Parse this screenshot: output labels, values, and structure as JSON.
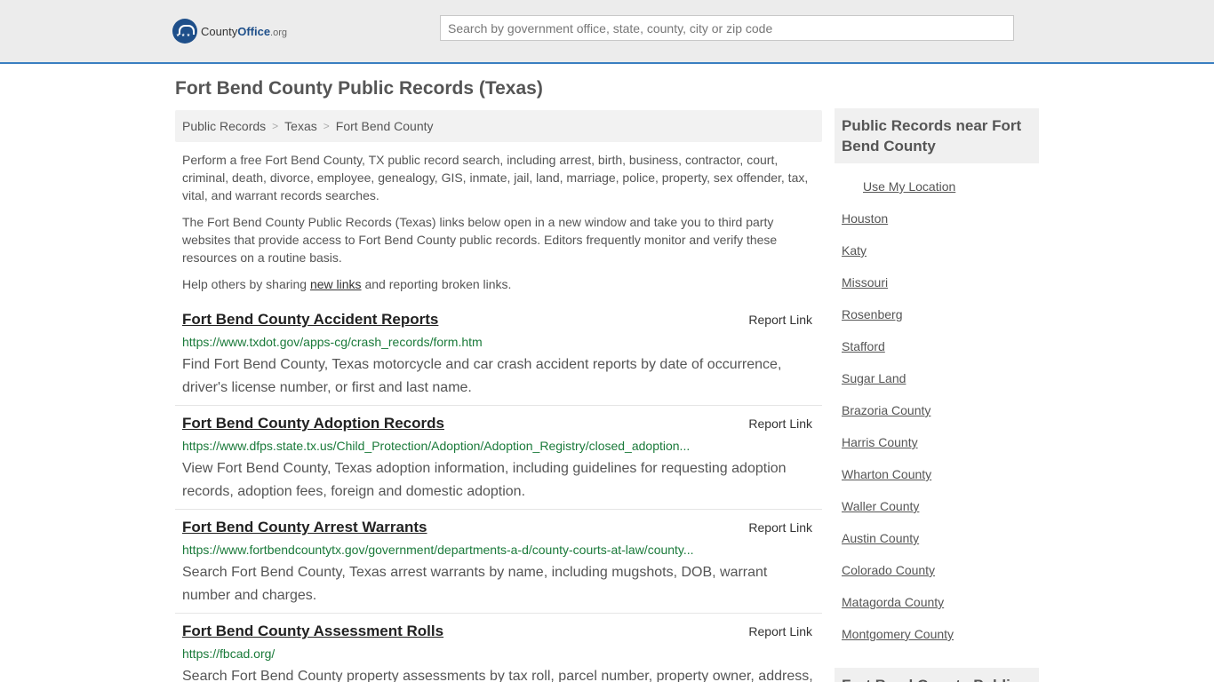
{
  "header": {
    "logo": {
      "county": "County",
      "office": "Office",
      "tld": ".org"
    },
    "search": {
      "placeholder": "Search by government office, state, county, city or zip code"
    }
  },
  "page": {
    "title": "Fort Bend County Public Records (Texas)"
  },
  "breadcrumb": [
    "Public Records",
    "Texas",
    "Fort Bend County"
  ],
  "intro": {
    "p1": "Perform a free Fort Bend County, TX public record search, including arrest, birth, business, contractor, court, criminal, death, divorce, employee, genealogy, GIS, inmate, jail, land, marriage, police, property, sex offender, tax, vital, and warrant records searches.",
    "p2": "The Fort Bend County Public Records (Texas) links below open in a new window and take you to third party websites that provide access to Fort Bend County public records. Editors frequently monitor and verify these resources on a routine basis.",
    "p3_before": "Help others by sharing ",
    "p3_link": "new links",
    "p3_after": " and reporting broken links."
  },
  "records": [
    {
      "title": "Fort Bend County Accident Reports",
      "report": "Report Link",
      "url": "https://www.txdot.gov/apps-cg/crash_records/form.htm",
      "desc": "Find Fort Bend County, Texas motorcycle and car crash accident reports by date of occurrence, driver's license number, or first and last name."
    },
    {
      "title": "Fort Bend County Adoption Records",
      "report": "Report Link",
      "url": "https://www.dfps.state.tx.us/Child_Protection/Adoption/Adoption_Registry/closed_adoption...",
      "desc": "View Fort Bend County, Texas adoption information, including guidelines for requesting adoption records, adoption fees, foreign and domestic adoption."
    },
    {
      "title": "Fort Bend County Arrest Warrants",
      "report": "Report Link",
      "url": "https://www.fortbendcountytx.gov/government/departments-a-d/county-courts-at-law/county...",
      "desc": "Search Fort Bend County, Texas arrest warrants by name, including mugshots, DOB, warrant number and charges."
    },
    {
      "title": "Fort Bend County Assessment Rolls",
      "report": "Report Link",
      "url": "https://fbcad.org/",
      "desc": "Search Fort Bend County property assessments by tax roll, parcel number, property owner, address,"
    }
  ],
  "sidebar": {
    "heading": "Public Records near Fort Bend County",
    "use_location": "Use My Location",
    "links": [
      "Houston",
      "Katy",
      "Missouri",
      "Rosenberg",
      "Stafford",
      "Sugar Land",
      "Brazoria County",
      "Harris County",
      "Wharton County",
      "Waller County",
      "Austin County",
      "Colorado County",
      "Matagorda County",
      "Montgomery County"
    ],
    "heading2": "Fort Bend County Public"
  }
}
